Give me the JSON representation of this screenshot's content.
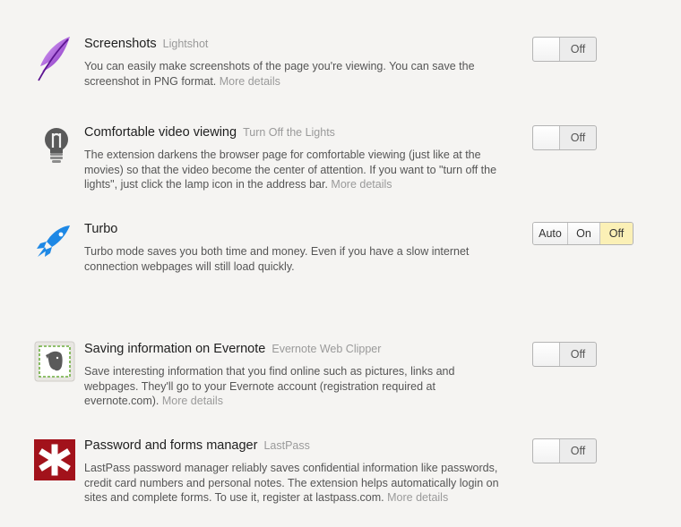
{
  "extensions": [
    {
      "title": "Screenshots",
      "vendor": "Lightshot",
      "description": "You can easily make screenshots of the page you're viewing. You can save the screenshot in PNG format.",
      "more": "More details",
      "toggle": "Off",
      "icon": "feather-icon"
    },
    {
      "title": "Comfortable video viewing",
      "vendor": "Turn Off the Lights",
      "description": "The extension darkens the browser page for comfortable viewing (just like at the movies) so that the video become the center of attention. If you want to \"turn off the lights\", just click the lamp icon in the address bar.",
      "more": "More details",
      "toggle": "Off",
      "icon": "lightbulb-icon"
    },
    {
      "title": "Turbo",
      "description": "Turbo mode saves you both time and money. Even if you have a slow internet connection webpages will still load quickly.",
      "modes": [
        "Auto",
        "On",
        "Off"
      ],
      "selected_mode": "Off",
      "icon": "rocket-icon"
    },
    {
      "title": "Saving information on Evernote",
      "vendor": "Evernote Web Clipper",
      "description": "Save interesting information that you find online such as pictures, links and webpages. They'll go to your Evernote account (registration required at evernote.com).",
      "more": "More details",
      "toggle": "Off",
      "icon": "evernote-elephant-icon"
    },
    {
      "title": "Password and forms manager",
      "vendor": "LastPass",
      "description": "LastPass password manager reliably saves confidential information like passwords, credit card numbers and personal notes. The extension helps automatically login on sites and complete forms. To use it, register at lastpass.com.",
      "more": "More details",
      "toggle": "Off",
      "icon": "lastpass-asterisk-icon"
    }
  ],
  "colors": {
    "background": "#f5f4f2",
    "selected_segment": "#fbf0b6",
    "muted_text": "#9a9a9a",
    "turbo_blue": "#1e88e5",
    "lastpass_red": "#a2121b"
  }
}
